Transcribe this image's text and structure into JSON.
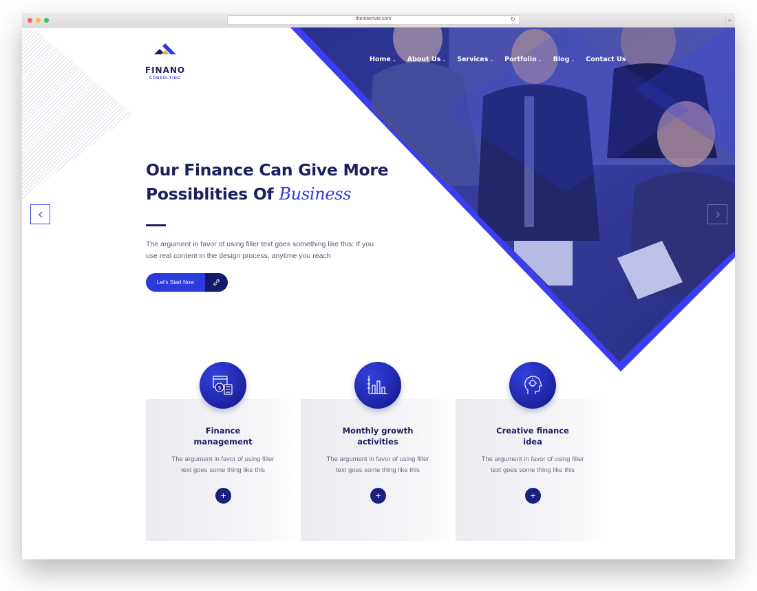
{
  "browser": {
    "url": "themexriver.com"
  },
  "logo": {
    "name": "FINANO",
    "tagline": "CONSULTING"
  },
  "nav": {
    "items": [
      {
        "label": "Home"
      },
      {
        "label": "About Us"
      },
      {
        "label": "Services"
      },
      {
        "label": "Portfolio"
      },
      {
        "label": "Blog"
      },
      {
        "label": "Contact Us"
      }
    ],
    "dropdown_glyph": "⌄"
  },
  "hero": {
    "title_line1": "Our Finance Can Give More",
    "title_line2_prefix": "Possiblities Of",
    "title_line2_emphasis": "Business",
    "description": "The argument in favor of using filler text goes something like this: If you use real content in the design process, anytime you reach",
    "cta_label": "Let's Start Now"
  },
  "cards": [
    {
      "icon": "finance-dashboard-icon",
      "title_line1": "Finance",
      "title_line2": "management",
      "description": "The argument in favor of using filler text goes some thing like this",
      "plus": "+"
    },
    {
      "icon": "growth-chart-icon",
      "title_line1": "Monthly growth",
      "title_line2": "activities",
      "description": "The argument in favor of using filler text goes some thing like this",
      "plus": "+"
    },
    {
      "icon": "idea-head-icon",
      "title_line1": "Creative finance",
      "title_line2": "idea",
      "description": "The argument in favor of using filler text goes some thing like this",
      "plus": "+"
    }
  ],
  "colors": {
    "primary_blue": "#2d3bdc",
    "navy": "#1c1f5e",
    "dark_navy": "#141a6a"
  }
}
